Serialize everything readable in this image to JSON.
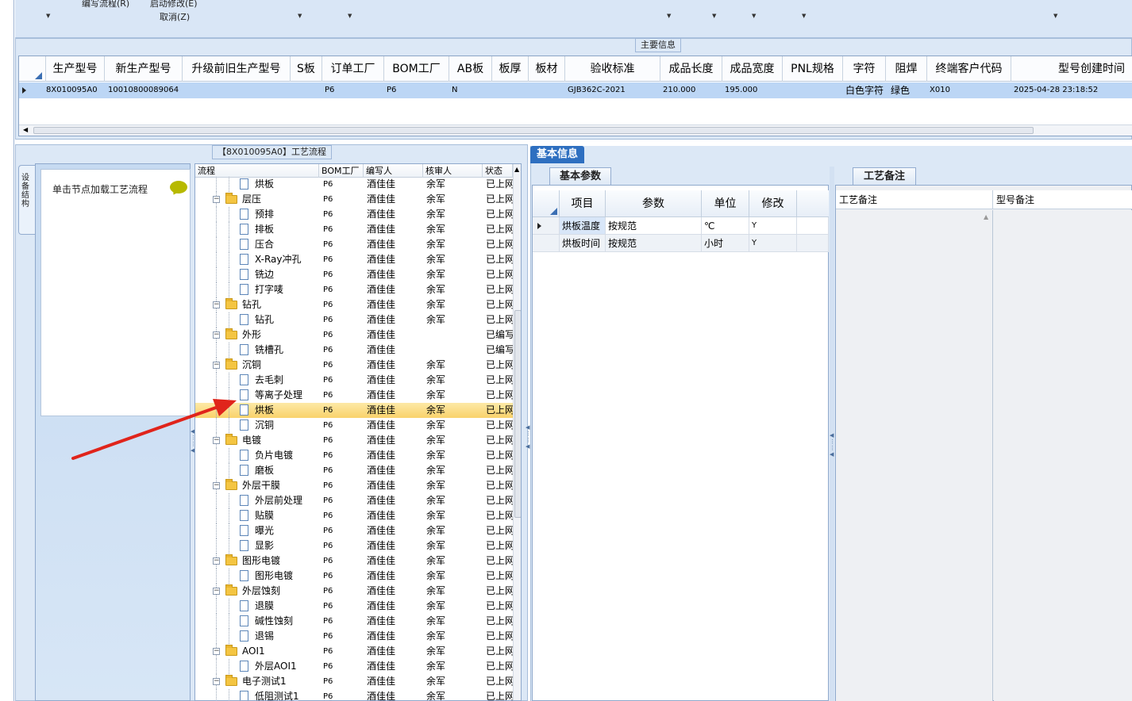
{
  "toolbar": {
    "edit_flow": "编写流程(R)",
    "start_modify": "启动修改(E)",
    "cancel": "取消(Z)"
  },
  "main_info": {
    "title": "主要信息",
    "columns": [
      "生产型号",
      "新生产型号",
      "升级前旧生产型号",
      "S板",
      "订单工厂",
      "BOM工厂",
      "AB板",
      "板厚",
      "板材",
      "验收标准",
      "成品长度",
      "成品宽度",
      "PNL规格",
      "字符",
      "阻焊",
      "终端客户代码",
      "型号创建时间"
    ],
    "row": {
      "prod_model": "8X010095A0",
      "new_model": "10010800089064",
      "old_model": "",
      "s_board": "",
      "order_factory": "P6",
      "bom_factory": "P6",
      "ab_board": "N",
      "thickness": "",
      "material": "",
      "standard": "GJB362C-2021",
      "length": "210.000",
      "width": "195.000",
      "pnl": "",
      "char": "白色字符",
      "solder": "绿色",
      "customer": "X010",
      "created": "2025-04-28 23:18:52"
    }
  },
  "process": {
    "title": "【8X010095A0】工艺流程",
    "side_tab": "设备结构",
    "hint": "单击节点加载工艺流程",
    "columns": [
      "流程",
      "BOM工厂",
      "编写人",
      "核审人",
      "状态"
    ],
    "rows": [
      {
        "name": "烘板",
        "level": 2,
        "bom": "P6",
        "writer": "酒佳佳",
        "checker": "余军",
        "status": "已上网"
      },
      {
        "name": "层压",
        "level": 1,
        "bom": "P6",
        "writer": "酒佳佳",
        "checker": "余军",
        "status": "已上网"
      },
      {
        "name": "预排",
        "level": 2,
        "bom": "P6",
        "writer": "酒佳佳",
        "checker": "余军",
        "status": "已上网"
      },
      {
        "name": "排板",
        "level": 2,
        "bom": "P6",
        "writer": "酒佳佳",
        "checker": "余军",
        "status": "已上网"
      },
      {
        "name": "压合",
        "level": 2,
        "bom": "P6",
        "writer": "酒佳佳",
        "checker": "余军",
        "status": "已上网"
      },
      {
        "name": "X-Ray冲孔",
        "level": 2,
        "bom": "P6",
        "writer": "酒佳佳",
        "checker": "余军",
        "status": "已上网"
      },
      {
        "name": "铣边",
        "level": 2,
        "bom": "P6",
        "writer": "酒佳佳",
        "checker": "余军",
        "status": "已上网"
      },
      {
        "name": "打字唛",
        "level": 2,
        "bom": "P6",
        "writer": "酒佳佳",
        "checker": "余军",
        "status": "已上网"
      },
      {
        "name": "钻孔",
        "level": 1,
        "bom": "P6",
        "writer": "酒佳佳",
        "checker": "余军",
        "status": "已上网"
      },
      {
        "name": "钻孔",
        "level": 2,
        "bom": "P6",
        "writer": "酒佳佳",
        "checker": "余军",
        "status": "已上网"
      },
      {
        "name": "外形",
        "level": 1,
        "bom": "P6",
        "writer": "酒佳佳",
        "checker": "",
        "status": "已编写"
      },
      {
        "name": "铣槽孔",
        "level": 2,
        "bom": "P6",
        "writer": "酒佳佳",
        "checker": "",
        "status": "已编写"
      },
      {
        "name": "沉铜",
        "level": 1,
        "bom": "P6",
        "writer": "酒佳佳",
        "checker": "余军",
        "status": "已上网"
      },
      {
        "name": "去毛刺",
        "level": 2,
        "bom": "P6",
        "writer": "酒佳佳",
        "checker": "余军",
        "status": "已上网"
      },
      {
        "name": "等离子处理",
        "level": 2,
        "bom": "P6",
        "writer": "酒佳佳",
        "checker": "余军",
        "status": "已上网"
      },
      {
        "name": "烘板",
        "level": 2,
        "bom": "P6",
        "writer": "酒佳佳",
        "checker": "余军",
        "status": "已上网",
        "selected": true
      },
      {
        "name": "沉铜",
        "level": 2,
        "bom": "P6",
        "writer": "酒佳佳",
        "checker": "余军",
        "status": "已上网"
      },
      {
        "name": "电镀",
        "level": 1,
        "bom": "P6",
        "writer": "酒佳佳",
        "checker": "余军",
        "status": "已上网"
      },
      {
        "name": "负片电镀",
        "level": 2,
        "bom": "P6",
        "writer": "酒佳佳",
        "checker": "余军",
        "status": "已上网"
      },
      {
        "name": "磨板",
        "level": 2,
        "bom": "P6",
        "writer": "酒佳佳",
        "checker": "余军",
        "status": "已上网"
      },
      {
        "name": "外层干膜",
        "level": 1,
        "bom": "P6",
        "writer": "酒佳佳",
        "checker": "余军",
        "status": "已上网"
      },
      {
        "name": "外层前处理",
        "level": 2,
        "bom": "P6",
        "writer": "酒佳佳",
        "checker": "余军",
        "status": "已上网"
      },
      {
        "name": "贴膜",
        "level": 2,
        "bom": "P6",
        "writer": "酒佳佳",
        "checker": "余军",
        "status": "已上网"
      },
      {
        "name": "曝光",
        "level": 2,
        "bom": "P6",
        "writer": "酒佳佳",
        "checker": "余军",
        "status": "已上网"
      },
      {
        "name": "显影",
        "level": 2,
        "bom": "P6",
        "writer": "酒佳佳",
        "checker": "余军",
        "status": "已上网"
      },
      {
        "name": "图形电镀",
        "level": 1,
        "bom": "P6",
        "writer": "酒佳佳",
        "checker": "余军",
        "status": "已上网"
      },
      {
        "name": "图形电镀",
        "level": 2,
        "bom": "P6",
        "writer": "酒佳佳",
        "checker": "余军",
        "status": "已上网"
      },
      {
        "name": "外层蚀刻",
        "level": 1,
        "bom": "P6",
        "writer": "酒佳佳",
        "checker": "余军",
        "status": "已上网"
      },
      {
        "name": "退膜",
        "level": 2,
        "bom": "P6",
        "writer": "酒佳佳",
        "checker": "余军",
        "status": "已上网"
      },
      {
        "name": "碱性蚀刻",
        "level": 2,
        "bom": "P6",
        "writer": "酒佳佳",
        "checker": "余军",
        "status": "已上网"
      },
      {
        "name": "退锡",
        "level": 2,
        "bom": "P6",
        "writer": "酒佳佳",
        "checker": "余军",
        "status": "已上网"
      },
      {
        "name": "AOI1",
        "level": 1,
        "bom": "P6",
        "writer": "酒佳佳",
        "checker": "余军",
        "status": "已上网"
      },
      {
        "name": "外层AOI1",
        "level": 2,
        "bom": "P6",
        "writer": "酒佳佳",
        "checker": "余军",
        "status": "已上网"
      },
      {
        "name": "电子测试1",
        "level": 1,
        "bom": "P6",
        "writer": "酒佳佳",
        "checker": "余军",
        "status": "已上网"
      },
      {
        "name": "低阻测试1",
        "level": 2,
        "bom": "P6",
        "writer": "酒佳佳",
        "checker": "余军",
        "status": "已上网"
      }
    ]
  },
  "basic_info": {
    "tab": "基本信息",
    "params_tab": "基本参数",
    "columns": [
      "项目",
      "参数",
      "单位",
      "修改"
    ],
    "rows": [
      {
        "item": "烘板温度",
        "param": "按规范",
        "unit": "℃",
        "modify": "Y"
      },
      {
        "item": "烘板时间",
        "param": "按规范",
        "unit": "小时",
        "modify": "Y"
      }
    ],
    "remarks_tab": "工艺备注",
    "remark_col1": "工艺备注",
    "remark_col2": "型号备注"
  },
  "colors": {
    "accent": "#2e6fc0",
    "selected_row": "#f9d26b",
    "arrow": "#e0241b"
  }
}
